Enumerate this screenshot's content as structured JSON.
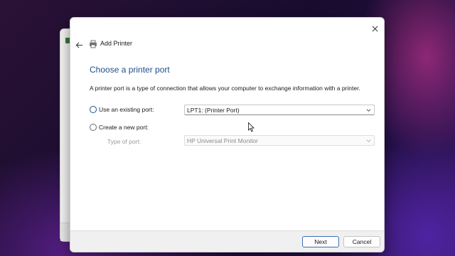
{
  "dialog": {
    "title": "Add Printer",
    "heading": "Choose a printer port",
    "description": "A printer port is a type of connection that allows your computer to exchange information with a printer.",
    "options": {
      "existing_port_label": "Use an existing port:",
      "existing_port_value": "LPT1: (Printer Port)",
      "new_port_label": "Create a new port:",
      "type_of_port_label": "Type of port:",
      "type_of_port_value": "HP Universal Print Monitor"
    },
    "buttons": {
      "next": "Next",
      "cancel": "Cancel"
    }
  },
  "icons": [
    "close-icon",
    "back-arrow-icon",
    "printer-icon",
    "chevron-down-icon",
    "mouse-cursor-icon"
  ],
  "colors": {
    "heading": "#1f4e8c",
    "accent": "#3c6fb5"
  }
}
